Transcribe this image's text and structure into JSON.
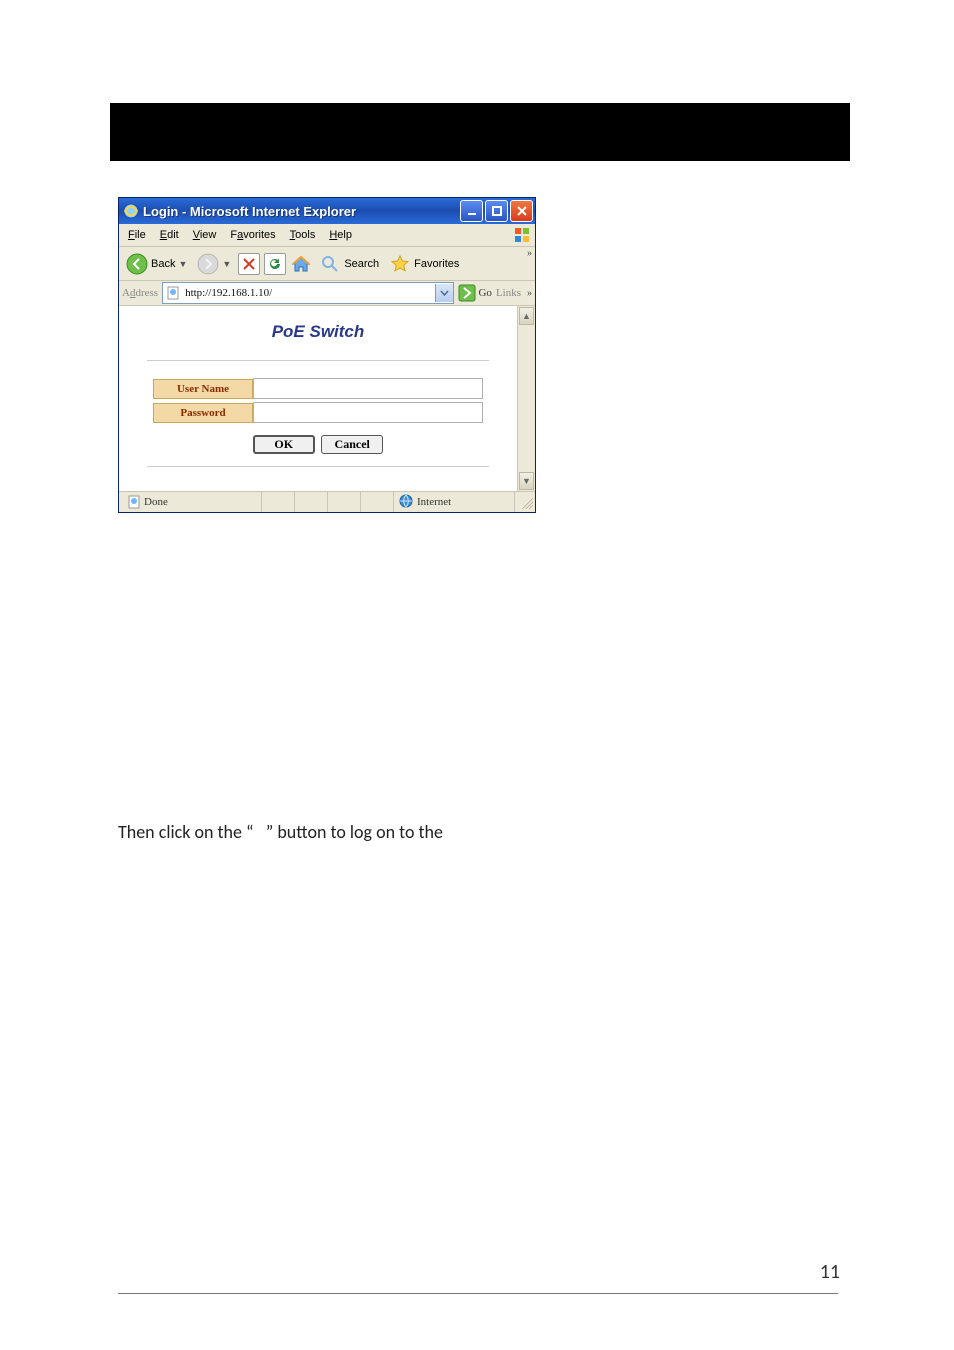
{
  "window": {
    "title": "Login - Microsoft Internet Explorer",
    "menubar": [
      "File",
      "Edit",
      "View",
      "Favorites",
      "Tools",
      "Help"
    ],
    "toolbar": {
      "back_label": "Back",
      "search_label": "Search",
      "favorites_label": "Favorites"
    },
    "address": {
      "label": "Address",
      "url": "http://192.168.1.10/",
      "go_label": "Go",
      "links_label": "Links"
    },
    "status": {
      "done": "Done",
      "zone": "Internet"
    }
  },
  "page": {
    "heading": "PoE Switch",
    "form": {
      "username_label": "User Name",
      "password_label": "Password",
      "ok_label": "OK",
      "cancel_label": "Cancel"
    }
  },
  "doc": {
    "sentence_a": "Then click on the “",
    "sentence_b": "” button to log on to the",
    "page_number": "11"
  }
}
